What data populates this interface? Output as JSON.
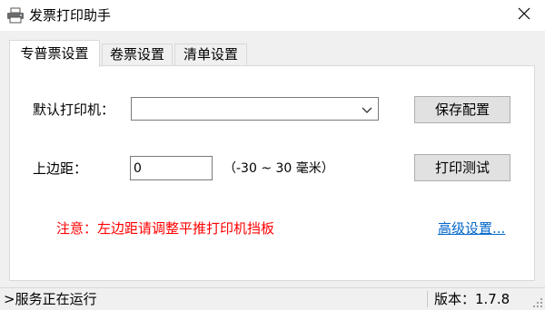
{
  "window": {
    "title": "发票打印助手",
    "close_glyph": "✕",
    "icon": "printer-icon"
  },
  "tabs": [
    {
      "label": "专普票设置",
      "active": true
    },
    {
      "label": "卷票设置",
      "active": false
    },
    {
      "label": "清单设置",
      "active": false
    }
  ],
  "settings": {
    "printer_label": "默认打印机：",
    "printer_value": "",
    "top_margin_label": "上边距：",
    "top_margin_value": "0",
    "top_margin_range": "（-30 ~ 30 毫米）",
    "save_button": "保存配置",
    "test_print_button": "打印测试",
    "warning_text": "注意：左边距请调整平推打印机挡板",
    "advanced_link": "高级设置..."
  },
  "colors": {
    "warning": "#ff0000",
    "link": "#0066cc"
  },
  "statusbar": {
    "status_text": ">服务正在运行",
    "version_text": "版本：1.7.8"
  }
}
